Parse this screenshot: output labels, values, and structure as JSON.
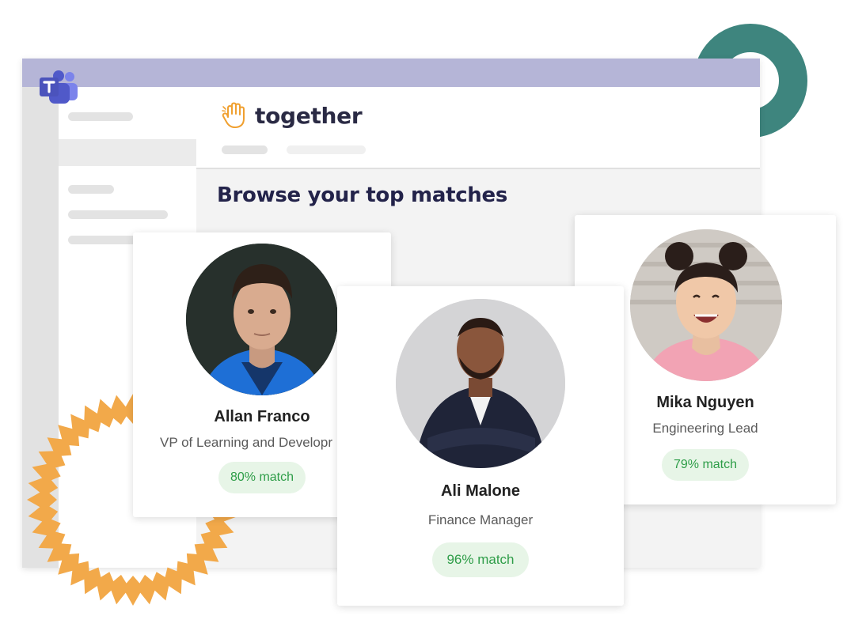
{
  "app": {
    "brand_name": "together",
    "page_heading": "Browse your top matches"
  },
  "icons": {
    "teams": "microsoft-teams-logo",
    "brand": "raised-hand-icon"
  },
  "colors": {
    "titlebar": "#b5b5d7",
    "ring": "#3e857e",
    "starburst": "#f2a94a",
    "heading": "#23234a",
    "badge_bg": "#e7f5e7",
    "badge_text": "#2e9d48",
    "brand_icon": "#f0a030"
  },
  "matches": [
    {
      "name": "Allan Franco",
      "role": "VP of Learning and Developr",
      "match": "80% match"
    },
    {
      "name": "Ali Malone",
      "role": "Finance Manager",
      "match": "96% match"
    },
    {
      "name": "Mika Nguyen",
      "role": "Engineering Lead",
      "match": "79% match"
    }
  ]
}
